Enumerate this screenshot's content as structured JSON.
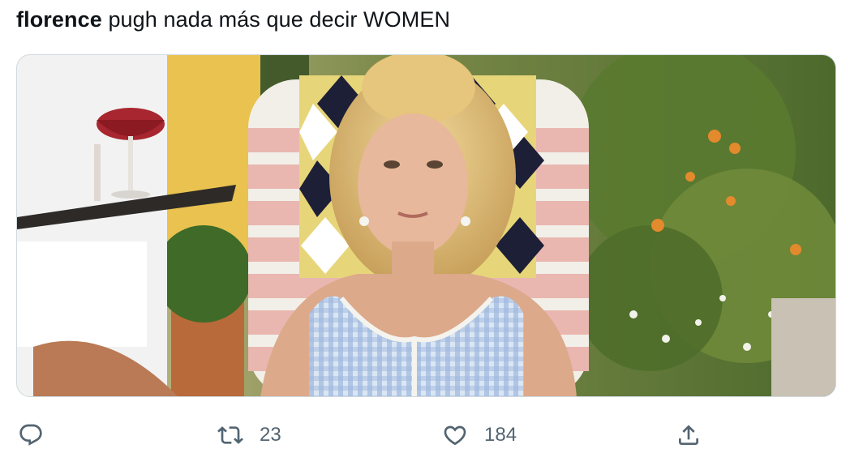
{
  "tweet": {
    "text_bold": "florence",
    "text_rest": " pugh nada más que decir WOMEN"
  },
  "media": {
    "alt": "Woman with blonde hair in a blue gingham top sitting in a pink lawn chair; a waiter with a tray of wine glasses on the left"
  },
  "actions": {
    "reply_icon": "reply-icon",
    "retweet_icon": "retweet-icon",
    "retweet_count": "23",
    "like_icon": "heart-icon",
    "like_count": "184",
    "share_icon": "share-icon"
  },
  "colors": {
    "text": "#0f1419",
    "secondary": "#536471",
    "border": "#cfd9de"
  }
}
